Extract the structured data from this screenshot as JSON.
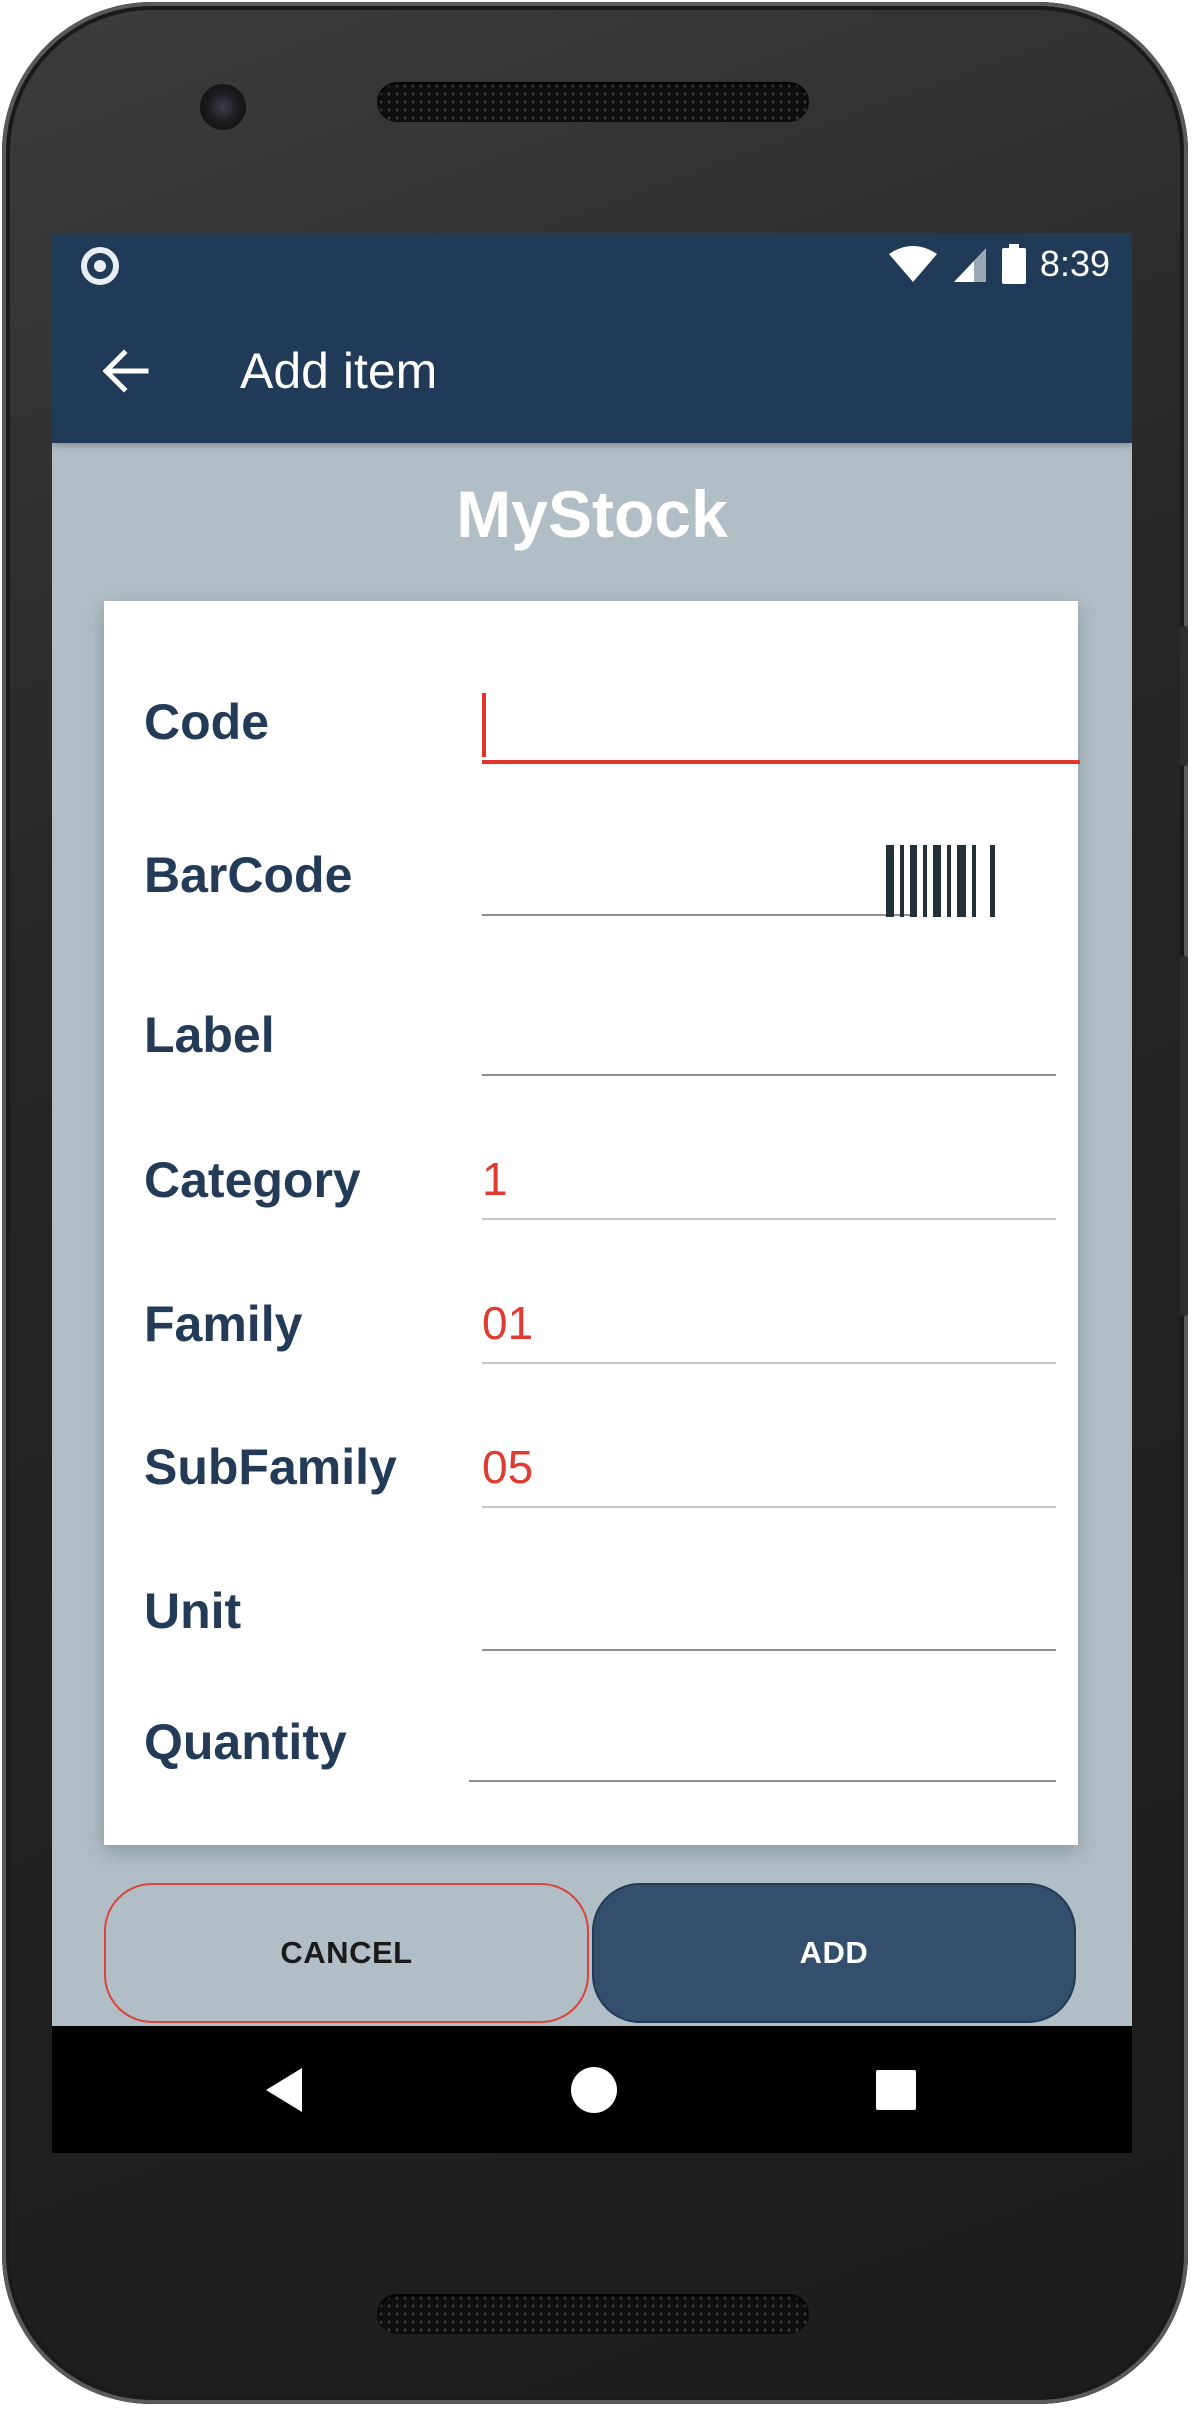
{
  "status_bar": {
    "time": "8:39",
    "icons": [
      "notification-dot-icon",
      "wifi-icon",
      "cell-signal-icon",
      "battery-icon"
    ]
  },
  "app_bar": {
    "title": "Add item",
    "back_icon": "back-arrow-icon"
  },
  "brand": "MyStock",
  "form": {
    "fields": [
      {
        "label": "Code",
        "value": ""
      },
      {
        "label": "BarCode",
        "value": ""
      },
      {
        "label": "Label",
        "value": ""
      },
      {
        "label": "Category",
        "value": "1"
      },
      {
        "label": "Family",
        "value": "01"
      },
      {
        "label": "SubFamily",
        "value": "05"
      },
      {
        "label": "Unit",
        "value": ""
      },
      {
        "label": "Quantity",
        "value": ""
      }
    ],
    "barcode_icon": "barcode-scan-icon"
  },
  "buttons": {
    "cancel": "CANCEL",
    "add": "ADD"
  },
  "nav": {
    "icons": [
      "back-icon",
      "home-icon",
      "recents-icon"
    ]
  },
  "colors": {
    "app_bar": "#203a58",
    "background": "#b1bec5",
    "label": "#243b57",
    "accent": "#e0352b",
    "add_button": "#334f6b"
  }
}
